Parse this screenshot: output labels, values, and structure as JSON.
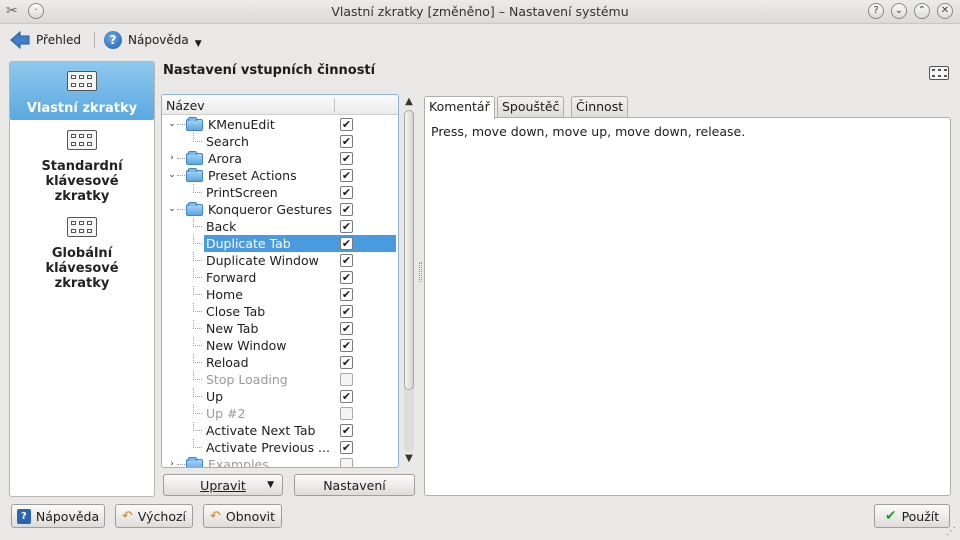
{
  "window": {
    "title": "Vlastní zkratky [změněno] – Nastavení systému"
  },
  "toolbar": {
    "overview_label": "Přehled",
    "help_label": "Nápověda"
  },
  "categories": [
    {
      "label": "Vlastní zkratky",
      "selected": true
    },
    {
      "label": "Standardní klávesové zkratky",
      "selected": false
    },
    {
      "label": "Globální klávesové zkratky",
      "selected": false
    }
  ],
  "heading": "Nastavení vstupních činností",
  "tree": {
    "column_name": "Název",
    "rows": [
      {
        "label": "KMenuEdit",
        "level": 0,
        "type": "folder",
        "expanded": true,
        "checked": true
      },
      {
        "label": "Search",
        "level": 1,
        "type": "item",
        "checked": true
      },
      {
        "label": "Arora",
        "level": 0,
        "type": "folder",
        "expanded": false,
        "checked": true
      },
      {
        "label": "Preset Actions",
        "level": 0,
        "type": "folder",
        "expanded": true,
        "checked": true
      },
      {
        "label": "PrintScreen",
        "level": 1,
        "type": "item",
        "checked": true
      },
      {
        "label": "Konqueror Gestures",
        "level": 0,
        "type": "folder",
        "expanded": true,
        "checked": true
      },
      {
        "label": "Back",
        "level": 1,
        "type": "item",
        "checked": true
      },
      {
        "label": "Duplicate Tab",
        "level": 1,
        "type": "item",
        "checked": true,
        "selected": true
      },
      {
        "label": "Duplicate Window",
        "level": 1,
        "type": "item",
        "checked": true
      },
      {
        "label": "Forward",
        "level": 1,
        "type": "item",
        "checked": true
      },
      {
        "label": "Home",
        "level": 1,
        "type": "item",
        "checked": true
      },
      {
        "label": "Close Tab",
        "level": 1,
        "type": "item",
        "checked": true
      },
      {
        "label": "New Tab",
        "level": 1,
        "type": "item",
        "checked": true
      },
      {
        "label": "New Window",
        "level": 1,
        "type": "item",
        "checked": true
      },
      {
        "label": "Reload",
        "level": 1,
        "type": "item",
        "checked": true
      },
      {
        "label": "Stop Loading",
        "level": 1,
        "type": "item",
        "checked": false,
        "disabled": true
      },
      {
        "label": "Up",
        "level": 1,
        "type": "item",
        "checked": true
      },
      {
        "label": "Up #2",
        "level": 1,
        "type": "item",
        "checked": false,
        "disabled": true
      },
      {
        "label": "Activate Next Tab",
        "level": 1,
        "type": "item",
        "checked": true
      },
      {
        "label": "Activate Previous ...",
        "level": 1,
        "type": "item",
        "checked": true
      },
      {
        "label": "Examples",
        "level": 0,
        "type": "folder",
        "expanded": false,
        "checked": false,
        "disabled": true
      }
    ]
  },
  "buttons": {
    "edit_label": "Upravit",
    "settings_label": "Nastavení",
    "help_label": "Nápověda",
    "defaults_label": "Výchozí",
    "reset_label": "Obnovit",
    "apply_label": "Použít"
  },
  "tabs": [
    {
      "label": "Komentář",
      "active": true
    },
    {
      "label": "Spouštěč",
      "active": false
    },
    {
      "label": "Činnost",
      "active": false
    }
  ],
  "comment_text": "Press, move down, move up, move down, release.",
  "icons": {
    "app": "tools-icon",
    "back": "arrow-left-icon",
    "help": "question-mark-icon",
    "keyboard": "keyboard-icon",
    "folder": "folder-icon",
    "apply": "checkmark-icon"
  },
  "colors": {
    "selection": "#4a9ae0",
    "category_selected": "#6fb6e6",
    "window_bg": "#e9e8e6"
  }
}
